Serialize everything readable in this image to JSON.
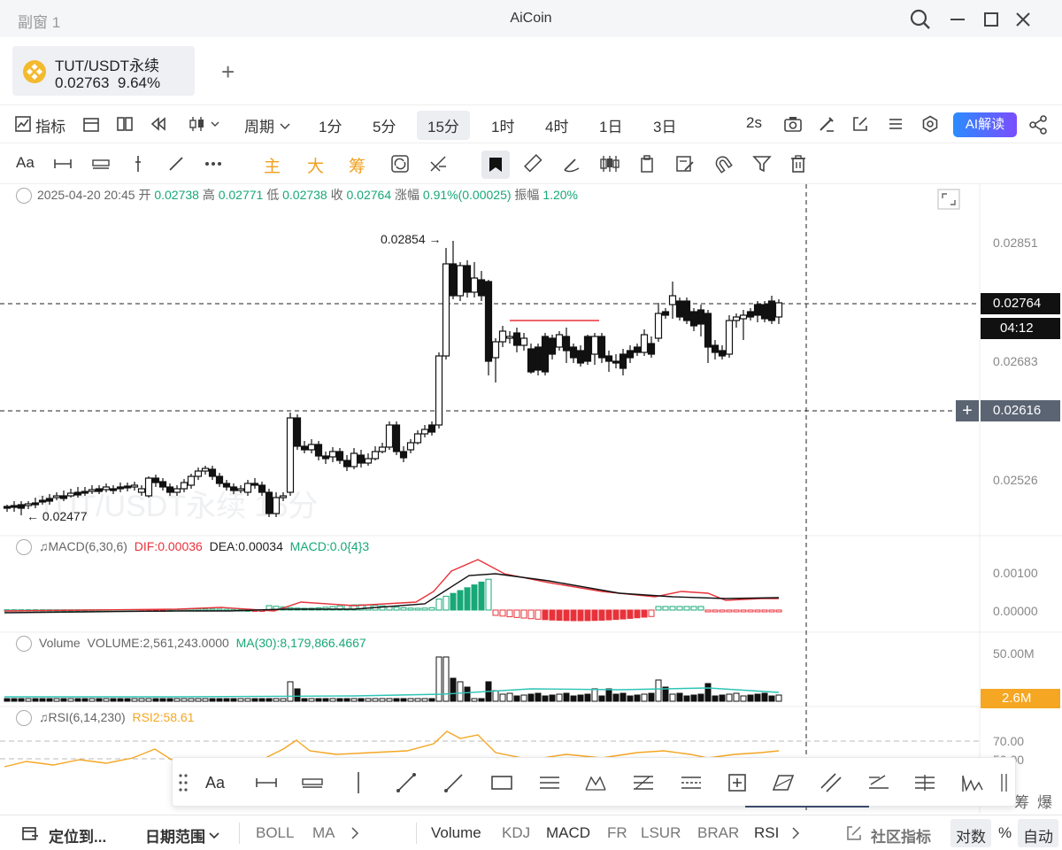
{
  "window": {
    "left_title": "副窗 1",
    "title": "AiCoin"
  },
  "tab": {
    "symbol": "TUT/USDT永续",
    "price": "0.02763",
    "change": "9.64%",
    "add": "+"
  },
  "toolbar1": {
    "indicator": "指标",
    "period": "周期",
    "intervals": [
      "1分",
      "5分",
      "15分",
      "1时",
      "4时",
      "1日",
      "3日"
    ],
    "selected_interval": "15分",
    "refresh": "2s",
    "ai": "AI解读"
  },
  "toolbar2": {
    "text_tool": "Aa",
    "zhu": "主",
    "da": "大",
    "chou": "筹"
  },
  "ohlc": {
    "datetime": "2025-04-20 20:45",
    "open_label": "开",
    "open": "0.02738",
    "high_label": "高",
    "high": "0.02771",
    "low_label": "低",
    "low": "0.02738",
    "close_label": "收",
    "close": "0.02764",
    "change_label": "涨幅",
    "change": "0.91%(0.00025)",
    "amp_label": "振幅",
    "amp": "1.20%"
  },
  "watermark": "TUT/USDT永续 15分",
  "price_axis": [
    "0.02851",
    "0.02683",
    "0.02526"
  ],
  "current_price": "0.02764",
  "countdown": "04:12",
  "cursor_price": "0.02616",
  "high_marker": "0.02854",
  "low_marker": "0.02477",
  "macd": {
    "label": "MACD(6,30,6)",
    "dif": "DIF:0.00036",
    "dea": "DEA:0.00034",
    "macd": "MACD:0.0{4}3",
    "axis": [
      "0.00100",
      "0.00000"
    ]
  },
  "volume": {
    "label": "Volume",
    "value": "VOLUME:2,561,243.0000",
    "ma": "MA(30):8,179,866.4667",
    "axis_top": "50.00M",
    "current": "2.6M"
  },
  "rsi": {
    "label": "RSI(6,14,230)",
    "rsi2": "RSI2:58.61",
    "axis": [
      "70.00",
      "50.00"
    ]
  },
  "side_labels": {
    "a": "筹",
    "b": "爆"
  },
  "bottombar": {
    "locate": "定位到...",
    "range": "日期范围",
    "main_inds": [
      "BOLL",
      "MA"
    ],
    "sub_inds": [
      "Volume",
      "KDJ",
      "MACD",
      "FR",
      "LSUR",
      "BRAR",
      "RSI"
    ],
    "community": "社区指标",
    "log": "对数",
    "percent": "%",
    "auto": "自动"
  },
  "colors": {
    "up": "#18a878",
    "down": "#e8323a",
    "rsi": "#f5a623",
    "accent": "#2b8cff"
  }
}
